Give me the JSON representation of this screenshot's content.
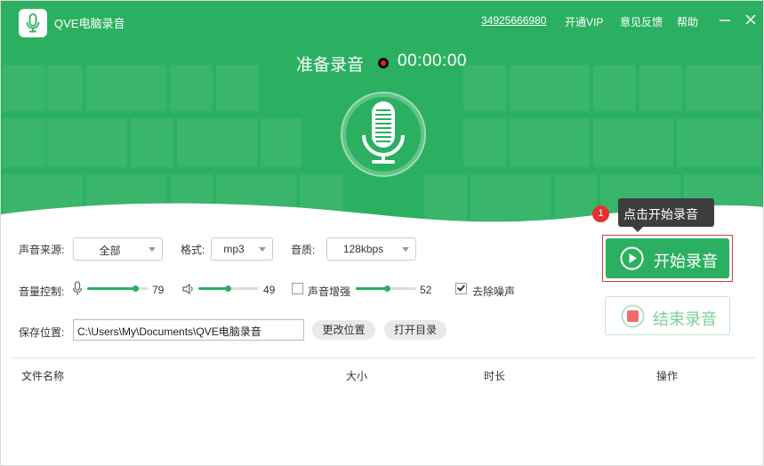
{
  "app": {
    "title": "QVE电脑录音"
  },
  "topbar": {
    "phone": "34925666980",
    "vip": "开通VIP",
    "feedback": "意见反馈",
    "help": "帮助"
  },
  "recorder": {
    "status": "准备录音",
    "timer": "00:00:00"
  },
  "settings": {
    "source_label": "声音来源:",
    "source_value": "全部",
    "format_label": "格式:",
    "format_value": "mp3",
    "quality_label": "音质:",
    "quality_value": "128kbps",
    "volume_label": "音量控制:",
    "mic_volume": "79",
    "speaker_volume": "49",
    "enhance_label": "声音增强",
    "enhance_value": "52",
    "enhance_checked": false,
    "denoise_label": "去除噪声",
    "denoise_checked": true,
    "save_label": "保存位置:",
    "save_path": "C:\\Users\\My\\Documents\\QVE电脑录音",
    "change_location": "更改位置",
    "open_dir": "打开目录"
  },
  "actions": {
    "start": "开始录音",
    "stop": "结束录音",
    "tooltip": "点击开始录音",
    "step": "1"
  },
  "file_table": {
    "columns": [
      "文件名称",
      "大小",
      "时长",
      "操作"
    ]
  },
  "colors": {
    "brand_green": "#2bb061",
    "highlight_red": "#e03a3a",
    "rec_dot": "#e0202a"
  }
}
